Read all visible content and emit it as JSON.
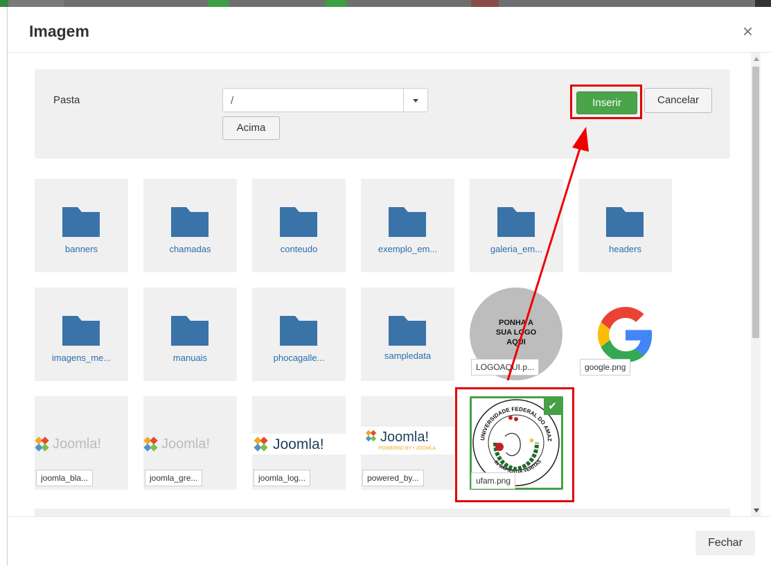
{
  "dialog": {
    "title": "Imagem",
    "close_symbol": "×"
  },
  "toolbar": {
    "folder_label": "Pasta",
    "folder_value": "/",
    "up_button": "Acima",
    "insert_button": "Inserir",
    "cancel_button": "Cancelar"
  },
  "items": [
    {
      "type": "folder",
      "label": "banners"
    },
    {
      "type": "folder",
      "label": "chamadas"
    },
    {
      "type": "folder",
      "label": "conteudo"
    },
    {
      "type": "folder",
      "label": "exemplo_em..."
    },
    {
      "type": "folder",
      "label": "galeria_em..."
    },
    {
      "type": "folder",
      "label": "headers"
    },
    {
      "type": "folder",
      "label": "imagens_me..."
    },
    {
      "type": "folder",
      "label": "manuais"
    },
    {
      "type": "folder",
      "label": "phocagalle..."
    },
    {
      "type": "folder",
      "label": "sampledata"
    },
    {
      "type": "image",
      "label": "LOGOAQUI.p...",
      "thumb_text": [
        "PONHA A",
        "SUA LOGO",
        "AQUI"
      ]
    },
    {
      "type": "image",
      "label": "google.png"
    },
    {
      "type": "image",
      "label": "joomla_bla...",
      "thumb_text": "Joomla!"
    },
    {
      "type": "image",
      "label": "joomla_gre...",
      "thumb_text": "Joomla!"
    },
    {
      "type": "image",
      "label": "joomla_log...",
      "thumb_text": "Joomla!"
    },
    {
      "type": "image",
      "label": "powered_by...",
      "thumb_text": "Joomla!",
      "thumb_subtext": "POWERED BY • JOOMLA"
    },
    {
      "type": "image",
      "label": "ufam.png",
      "selected": true,
      "thumb_text_top": "UNIVERSIDADE FEDERAL DO AMAZONAS",
      "thumb_text_bottom": "IN SAPIENTIA VERITAS"
    }
  ],
  "footer": {
    "close_button": "Fechar"
  },
  "colors": {
    "folder": "#3a73a8",
    "primary": "#4aa54a",
    "highlight": "#e00000",
    "link": "#2a6db0"
  }
}
